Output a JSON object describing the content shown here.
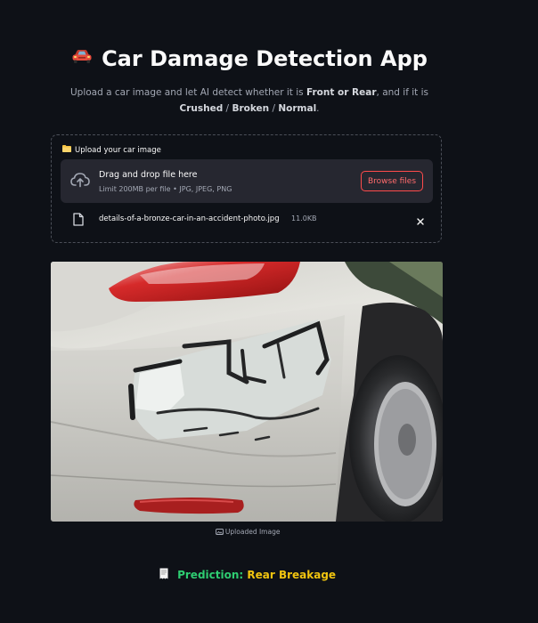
{
  "app": {
    "title": "Car Damage Detection App",
    "title_icon": "car-icon"
  },
  "intro": {
    "prefix": "Upload a car image and let AI detect whether it is ",
    "front_or_rear": "Front or Rear",
    "middle": ", and if it is ",
    "crushed": "Crushed",
    "sep1": " / ",
    "broken": "Broken",
    "sep2": " / ",
    "normal": "Normal",
    "end": "."
  },
  "uploader": {
    "label": "Upload your car image",
    "label_icon": "folder-icon",
    "drop_title": "Drag and drop file here",
    "drop_limit": "Limit 200MB per file • JPG, JPEG, PNG",
    "browse_label": "Browse files",
    "file": {
      "name": "details-of-a-bronze-car-in-an-accident-photo.jpg",
      "size": "11.0KB"
    }
  },
  "image": {
    "caption": "Uploaded Image",
    "caption_icon": "photo-icon"
  },
  "result": {
    "icon": "receipt-icon",
    "label": "Prediction:",
    "value": "Rear Breakage"
  },
  "colors": {
    "background": "#0e1117",
    "dropzone": "#262730",
    "accent": "#ff4b4b",
    "prediction_label": "#2ecc71",
    "prediction_value": "#f1c40f"
  }
}
